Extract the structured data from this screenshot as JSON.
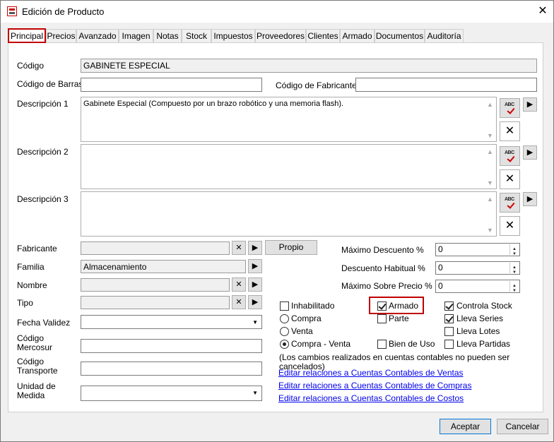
{
  "window": {
    "title": "Edición de Producto",
    "close_glyph": "✕"
  },
  "tabs": [
    "Principal",
    "Precios",
    "Avanzado",
    "Imagen",
    "Notas",
    "Stock",
    "Impuestos",
    "Proveedores",
    "Clientes",
    "Armado",
    "Documentos",
    "Auditoría"
  ],
  "form": {
    "codigo_label": "Código",
    "codigo_value": "GABINETE ESPECIAL",
    "barras_label": "Código de Barras",
    "barras_value": "",
    "fabricante_code_label": "Código de Fabricante",
    "fabricante_code_value": "",
    "desc1_label": "Descripción 1",
    "desc1_value": "Gabinete Especial (Compuesto por un brazo robótico y una memoria flash).",
    "desc2_label": "Descripción 2",
    "desc2_value": "",
    "desc3_label": "Descripción 3",
    "desc3_value": "",
    "fabricante_label": "Fabricante",
    "fabricante_value": "",
    "propio_label": "Propio",
    "familia_label": "Familia",
    "familia_value": "Almacenamiento",
    "nombre_label": "Nombre",
    "nombre_value": "",
    "tipo_label": "Tipo",
    "tipo_value": "",
    "fecha_label": "Fecha Validez",
    "fecha_value": "",
    "mercosur_label1": "Código",
    "mercosur_label2": "Mercosur",
    "mercosur_value": "",
    "transporte_label1": "Código",
    "transporte_label2": "Transporte",
    "transporte_value": "",
    "unidad_label1": "Unidad de",
    "unidad_label2": "Medida",
    "unidad_value": ""
  },
  "discounts": {
    "max_desc_label": "Máximo Descuento %",
    "max_desc_value": "0",
    "habitual_label": "Descuento Habitual %",
    "habitual_value": "0",
    "sobre_precio_label": "Máximo Sobre Precio %",
    "sobre_precio_value": "0"
  },
  "options": {
    "inhabilitado": "Inhabilitado",
    "armado": "Armado",
    "controla_stock": "Controla Stock",
    "compra": "Compra",
    "parte": "Parte",
    "lleva_series": "Lleva Series",
    "venta": "Venta",
    "lleva_lotes": "Lleva Lotes",
    "compra_venta": "Compra - Venta",
    "bien_de_uso": "Bien de Uso",
    "lleva_partidas": "Lleva Partidas",
    "note": "(Los cambios realizados en cuentas contables no pueden ser cancelados)"
  },
  "links": {
    "ventas": "Editar relaciones a Cuentas Contables de Ventas",
    "compras": "Editar relaciones a Cuentas Contables de Compras",
    "costos": "Editar relaciones a Cuentas Contables de Costos"
  },
  "footer": {
    "accept": "Aceptar",
    "cancel": "Cancelar"
  },
  "spell_text": "ABC",
  "glyphs": {
    "clear": "✕",
    "arrow": "▶",
    "up": "▲",
    "down": "▼",
    "drop": "▼"
  }
}
